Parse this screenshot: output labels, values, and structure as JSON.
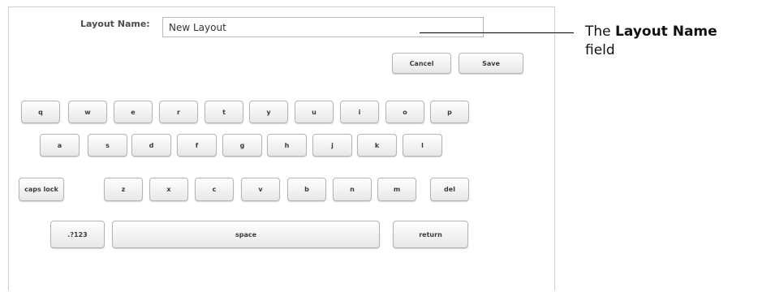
{
  "form": {
    "layout_name_label": "Layout Name:",
    "layout_name_value": "New Layout"
  },
  "buttons": {
    "cancel": "Cancel",
    "save": "Save"
  },
  "keyboard": {
    "row1": [
      "q",
      "w",
      "e",
      "r",
      "t",
      "y",
      "u",
      "i",
      "o",
      "p"
    ],
    "row2": [
      "a",
      "s",
      "d",
      "f",
      "g",
      "h",
      "j",
      "k",
      "l"
    ],
    "row3": [
      "caps lock",
      "z",
      "x",
      "c",
      "v",
      "b",
      "n",
      "m",
      "del"
    ],
    "row4": [
      ".?123",
      "space",
      "return"
    ]
  },
  "callout": {
    "prefix": "The ",
    "bold": "Layout Name",
    "suffix": "field"
  }
}
